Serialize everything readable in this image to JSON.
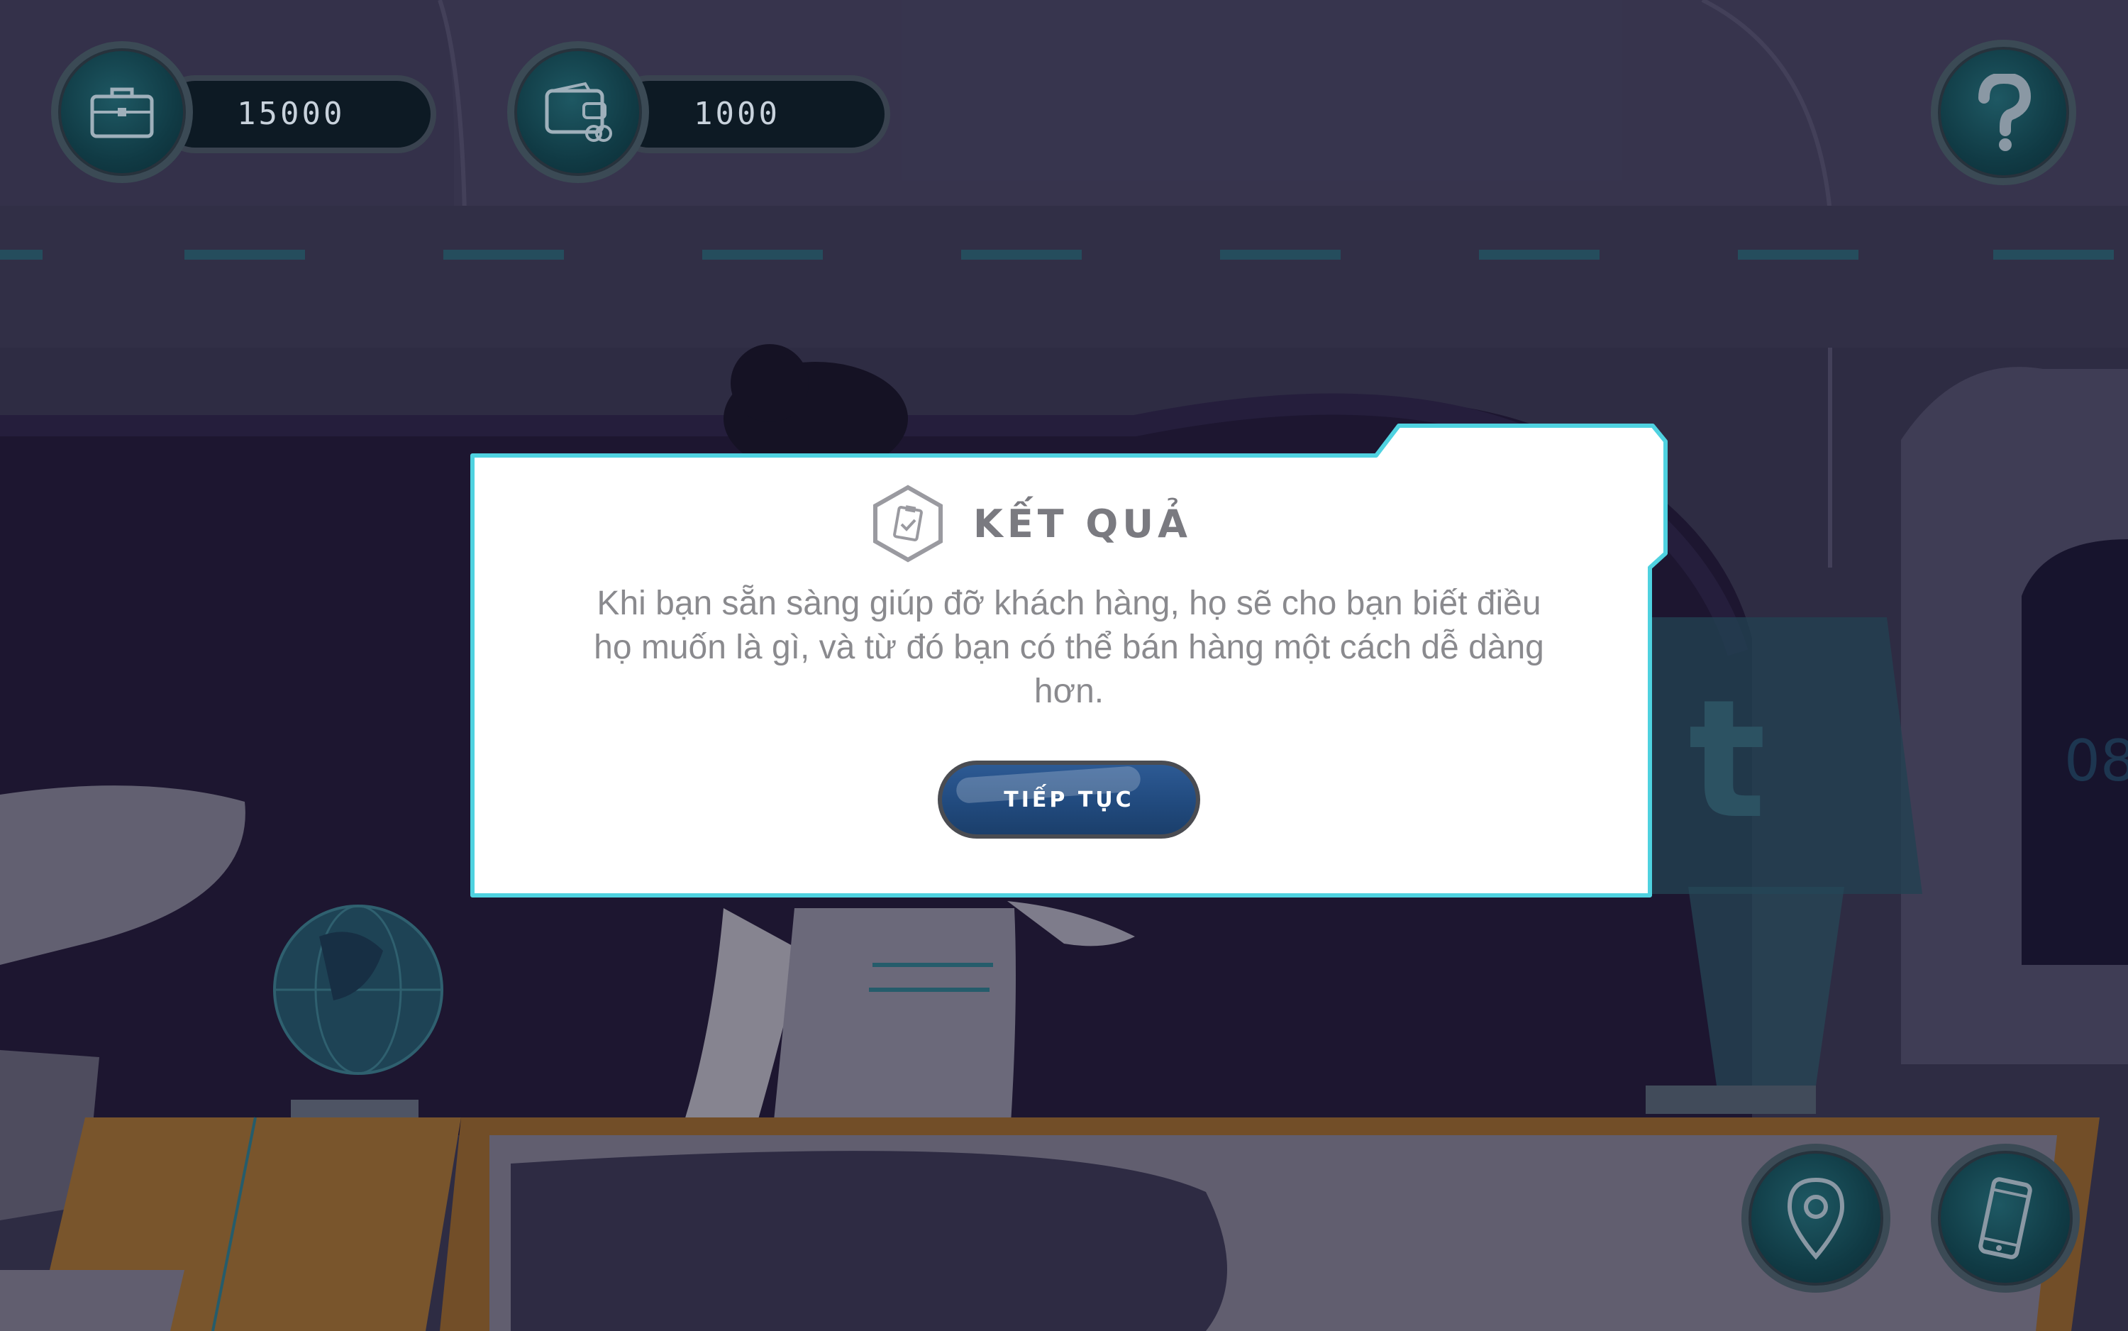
{
  "hud": {
    "money": {
      "icon": "briefcase-icon",
      "value": "15000"
    },
    "wallet": {
      "icon": "wallet-icon",
      "value": "1000"
    },
    "help": {
      "icon": "question-icon"
    },
    "map": {
      "icon": "map-pin-icon"
    },
    "phone": {
      "icon": "smartphone-icon"
    }
  },
  "dialog": {
    "icon": "clipboard-check-icon",
    "title": "KẾT QUẢ",
    "message": "Khi bạn sẵn sàng giúp đỡ khách hàng, họ sẽ cho bạn biết điều họ muốn là gì, và từ đó bạn có thể bán hàng một cách dễ dàng hơn.",
    "continue_label": "TIẾP TỤC"
  },
  "colors": {
    "dialog_border": "#4fd2e0",
    "button": "#214a7e",
    "hud_circle": "#123f49",
    "desk": "#b07a2e"
  }
}
